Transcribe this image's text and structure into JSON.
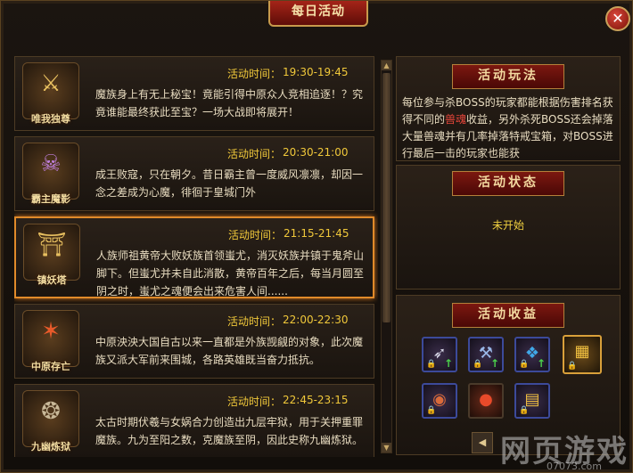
{
  "window": {
    "title": "每日活动",
    "close_symbol": "✕"
  },
  "activities": [
    {
      "emblem_name": "唯我独尊",
      "emblem_glyph": "⚔",
      "time_label": "活动时间：",
      "time": "19:30-19:45",
      "desc": "魔族身上有无上秘宝！竟能引得中原众人竞相追逐！？究竟谁能最终获此至宝？一场大战即将展开！",
      "active": false
    },
    {
      "emblem_name": "霸主魔影",
      "emblem_glyph": "☠",
      "time_label": "活动时间：",
      "time": "20:30-21:00",
      "desc": "成王败寇，只在朝夕。昔日霸主曾一度威风凛凛，却因一念之差成为心魔，徘徊于皇城门外",
      "active": false
    },
    {
      "emblem_name": "镇妖塔",
      "emblem_glyph": "⛩",
      "time_label": "活动时间：",
      "time": "21:15-21:45",
      "desc": "人族师祖黄帝大败妖族首领蚩尤，消灭妖族并镇于鬼斧山脚下。但蚩尤并未自此消散，黄帝百年之后，每当月圆至阴之时，蚩尤之魂便会出来危害人间......",
      "active": true
    },
    {
      "emblem_name": "中原存亡",
      "emblem_glyph": "✶",
      "time_label": "活动时间：",
      "time": "22:00-22:30",
      "desc": "中原泱泱大国自古以来一直都是外族觊觎的对象，此次魔族又派大军前来围城，各路英雄既当奋力抵抗。",
      "active": false
    },
    {
      "emblem_name": "九幽炼狱",
      "emblem_glyph": "❂",
      "time_label": "活动时间：",
      "time": "22:45-23:15",
      "desc": "太古时期伏羲与女娲合力创造出九层牢狱，用于关押重罪魔族。九为至阳之数，克魔族至阴，因此史称九幽炼狱。",
      "active": false
    }
  ],
  "rules_panel": {
    "title": "活动玩法",
    "text_before": "每位参与杀BOSS的玩家都能根据伤害排名获得不同的",
    "highlight": "兽魂",
    "text_after": "收益，另外杀死BOSS还会掉落大量兽魂并有几率掉落特戒宝箱，对BOSS进行最后一击的玩家也能获"
  },
  "status_panel": {
    "title": "活动状态",
    "status": "未开始"
  },
  "rewards_panel": {
    "title": "活动收益",
    "items": [
      {
        "icon": "bow-icon",
        "glyph": "➶",
        "lock": "🔒",
        "up": "↑",
        "style": "blue"
      },
      {
        "icon": "axe-icon",
        "glyph": "⚒",
        "lock": "🔒",
        "up": "↑",
        "style": "blue"
      },
      {
        "icon": "crystal-icon",
        "glyph": "❖",
        "lock": "🔒",
        "up": "↑",
        "style": "blue"
      },
      {
        "icon": "treasure-chest-icon",
        "glyph": "▦",
        "lock": "🔒",
        "up": "",
        "style": "gold"
      },
      {
        "icon": "beast-soul-icon",
        "glyph": "◉",
        "lock": "🔒",
        "up": "",
        "style": "blue"
      },
      {
        "icon": "red-orb-icon",
        "glyph": "●",
        "lock": "",
        "up": "",
        "style": "red"
      },
      {
        "icon": "gold-bars-icon",
        "glyph": "▤",
        "lock": "🔒",
        "up": "",
        "style": "blue"
      }
    ]
  },
  "pager": {
    "prev": "◀"
  },
  "watermark": {
    "text": "网页游戏",
    "sub": "07073.com"
  }
}
